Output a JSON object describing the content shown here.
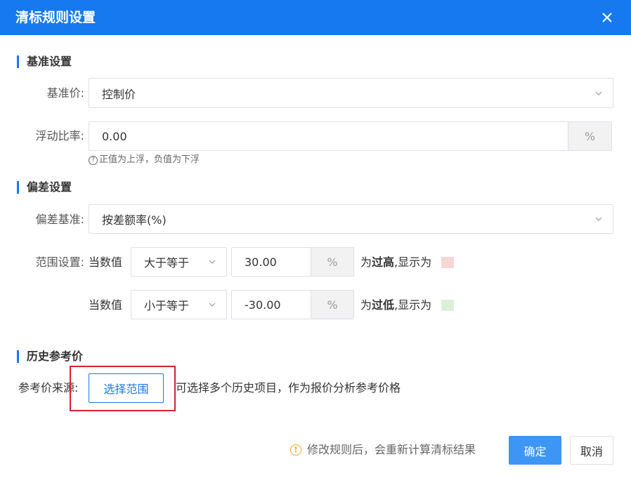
{
  "dialog": {
    "title": "清标规则设置"
  },
  "baseline_section": {
    "title": "基准设置",
    "base_price_label": "基准价:",
    "base_price_value": "控制价",
    "float_rate_label": "浮动比率:",
    "float_rate_value": "0.00",
    "float_rate_suffix": "%",
    "hint": "正值为上浮，负值为下浮"
  },
  "deviation_section": {
    "title": "偏差设置",
    "basis_label": "偏差基准:",
    "basis_value": "按差额率(%)",
    "range_label": "范围设置:",
    "rows": [
      {
        "prefix": "当数值",
        "operator": "大于等于",
        "value": "30.00",
        "suffix": "%",
        "result_prefix": "为",
        "result_bold": "过高",
        "result_suffix": ",显示为",
        "color": "#f8d6d6"
      },
      {
        "prefix": "当数值",
        "operator": "小于等于",
        "value": "-30.00",
        "suffix": "%",
        "result_prefix": "为",
        "result_bold": "过低",
        "result_suffix": ",显示为",
        "color": "#dcf0d6"
      }
    ]
  },
  "history_section": {
    "title": "历史参考价",
    "source_label": "参考价来源:",
    "select_button": "选择范围",
    "description": "可选择多个历史项目，作为报价分析参考价格"
  },
  "footer": {
    "note": "修改规则后，会重新计算清标结果",
    "confirm": "确定",
    "cancel": "取消"
  },
  "colors": {
    "accent": "#1679f0",
    "highlight": "#d9232d"
  }
}
